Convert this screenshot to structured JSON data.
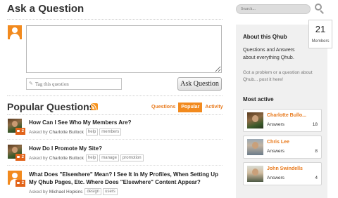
{
  "page": {
    "title": "Ask a Question"
  },
  "ask": {
    "tag_placeholder": "Tag this question",
    "submit_label": "Ask Question"
  },
  "popular": {
    "title": "Popular Questions",
    "tabs": [
      {
        "label": "Questions",
        "active": false
      },
      {
        "label": "Popular",
        "active": true
      },
      {
        "label": "Activity",
        "active": false
      }
    ],
    "asked_by_prefix": "Asked by",
    "questions": [
      {
        "title": "How Can I See Who My Members Are?",
        "author": "Charlotte Bullock",
        "answers": "2",
        "tags": [
          "help",
          "members"
        ],
        "avatar": "photo"
      },
      {
        "title": "How Do I Promote My Site?",
        "author": "Charlotte Bullock",
        "answers": "2",
        "tags": [
          "help",
          "manage",
          "promotion"
        ],
        "avatar": "photo"
      },
      {
        "title": "What Does \"Elsewhere\" Mean? I See It In My Profiles, When Setting Up My Qhub Pages, Etc. Where Does \"Elsewhere\" Content Appear?",
        "author": "Michael Hopkins",
        "answers": "2",
        "tags": [
          "design",
          "users"
        ],
        "avatar": "default"
      }
    ]
  },
  "search": {
    "placeholder": "Search..."
  },
  "members_box": {
    "count": "21",
    "label": "Members"
  },
  "about": {
    "title": "About this Qhub",
    "description": "Questions and Answers about everything Qhub.",
    "help": "Got a problem or a question about Qhub... post it here!"
  },
  "most_active": {
    "title": "Most active",
    "answers_label": "Answers",
    "members": [
      {
        "name": "Charlotte Bullo...",
        "count": "18"
      },
      {
        "name": "Chris Lee",
        "count": "8"
      },
      {
        "name": "John Swindells",
        "count": "4"
      }
    ]
  },
  "colors": {
    "accent": "#f28a1e",
    "badge": "#e2641a",
    "sidebar_bg": "#f0f0f0"
  }
}
